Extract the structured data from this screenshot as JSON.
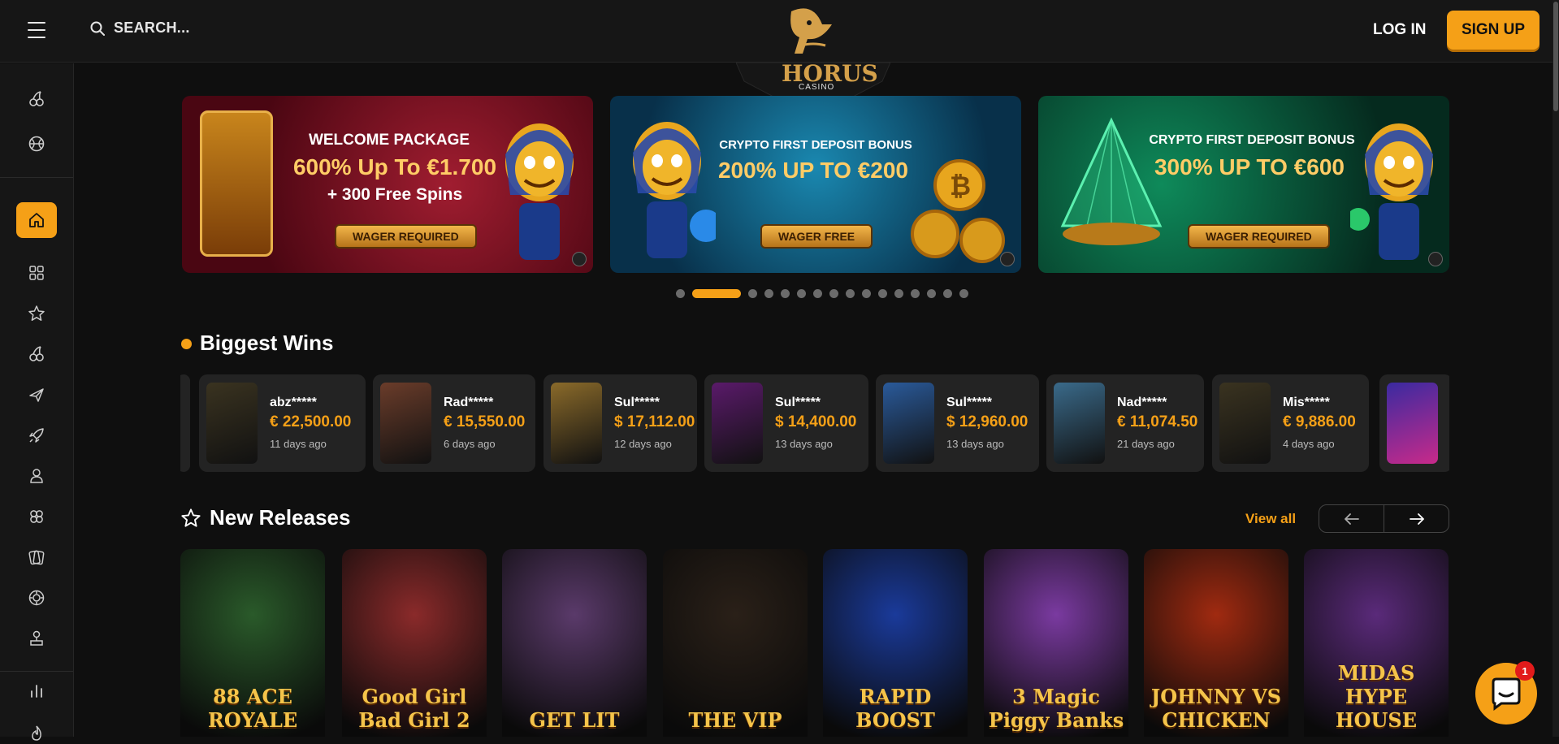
{
  "header": {
    "search_placeholder": "SEARCH...",
    "logo_text": "HORUS",
    "logo_sub": "CASINO",
    "login_label": "LOG IN",
    "signup_label": "SIGN UP"
  },
  "sidebar": {
    "icons": [
      "cherries-icon",
      "sports-ball-icon",
      "home-icon",
      "grid-icon",
      "star-icon",
      "cherries-icon",
      "airplane-icon",
      "rocket-icon",
      "dealer-icon",
      "clover-icon",
      "cards-icon",
      "poker-chip-icon",
      "lottery-icon",
      "stats-icon",
      "flame-icon"
    ]
  },
  "banners": [
    {
      "title": "WELCOME PACKAGE",
      "line1": "600% Up To €1.700",
      "line2": "+ 300 Free Spins",
      "badge": "WAGER REQUIRED",
      "theme": "#7a1020"
    },
    {
      "title": "CRYPTO FIRST DEPOSIT BONUS",
      "line1": "200% UP TO €200",
      "line2": "",
      "badge": "WAGER FREE",
      "theme": "#0d4a7a"
    },
    {
      "title": "CRYPTO FIRST DEPOSIT BONUS",
      "line1": "300% UP TO €600",
      "line2": "",
      "badge": "WAGER REQUIRED",
      "theme": "#0b5a3a"
    }
  ],
  "carousel": {
    "count": 16,
    "active_index": 1
  },
  "biggest_wins": {
    "title": "Biggest Wins",
    "items": [
      {
        "user": "abz*****",
        "amount": "€ 22,500.00",
        "time": "11 days ago",
        "color": "#3a3320"
      },
      {
        "user": "Rad*****",
        "amount": "€ 15,550.00",
        "time": "6 days ago",
        "color": "#6a3c2a"
      },
      {
        "user": "Sul*****",
        "amount": "$ 17,112.00",
        "time": "12 days ago",
        "color": "#8a6a2a"
      },
      {
        "user": "Sul*****",
        "amount": "$ 14,400.00",
        "time": "13 days ago",
        "color": "#5a1a6a"
      },
      {
        "user": "Sul*****",
        "amount": "$ 12,960.00",
        "time": "13 days ago",
        "color": "#2a5a9a"
      },
      {
        "user": "Nad*****",
        "amount": "€ 11,074.50",
        "time": "21 days ago",
        "color": "#3a6a8a"
      },
      {
        "user": "Mis*****",
        "amount": "€ 9,886.00",
        "time": "4 days ago",
        "color": "#3a3320"
      }
    ]
  },
  "new_releases": {
    "title": "New Releases",
    "view_all": "View all",
    "games": [
      {
        "name": "88 ACE ROYALE",
        "color": "#2a5a2a"
      },
      {
        "name": "Good Girl Bad Girl 2",
        "color": "#8a2a2a"
      },
      {
        "name": "GET LIT",
        "color": "#5a3a6a"
      },
      {
        "name": "THE VIP",
        "color": "#2a2018"
      },
      {
        "name": "RAPID BOOST",
        "color": "#1a3a9a"
      },
      {
        "name": "3 Magic Piggy Banks",
        "color": "#7a3aa0"
      },
      {
        "name": "JOHNNY VS CHICKEN",
        "color": "#a02a10"
      },
      {
        "name": "MIDAS HYPE HOUSE",
        "color": "#5a2a7a"
      }
    ]
  },
  "chat": {
    "badge_count": "1"
  }
}
